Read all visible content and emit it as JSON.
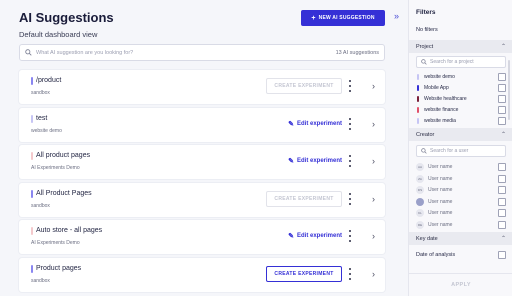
{
  "header": {
    "title": "AI Suggestions",
    "subtitle": "Default dashboard view",
    "new_button": "NEW AI SUGGESTION",
    "new_button_icon": "plus-icon"
  },
  "search": {
    "placeholder": "What AI suggestion are you looking for?",
    "count": "13 AI suggestions"
  },
  "cards": [
    {
      "name": "/product",
      "project": "sandbox",
      "action": "CREATE EXPERIMENT",
      "action_type": "disabled",
      "color": "#8a86f0"
    },
    {
      "name": "test",
      "project": "website demo",
      "action": "Edit experiment",
      "action_type": "edit",
      "color": "#c6c5f4"
    },
    {
      "name": "All product pages",
      "project": "AI Experiments Demo",
      "action": "Edit experiment",
      "action_type": "edit",
      "color": "#f4c9cc"
    },
    {
      "name": "All Product Pages",
      "project": "sandbox",
      "action": "CREATE EXPERIMENT",
      "action_type": "disabled",
      "color": "#8a86f0"
    },
    {
      "name": "Auto store - all pages",
      "project": "AI Experiments Demo",
      "action": "Edit experiment",
      "action_type": "edit",
      "color": "#f4c9cc"
    },
    {
      "name": "Product pages",
      "project": "sandbox",
      "action": "CREATE EXPERIMENT",
      "action_type": "enabled",
      "color": "#8a86f0"
    }
  ],
  "filters": {
    "title": "Filters",
    "no_filters": "No filters",
    "project_section": "Project",
    "project_search_placeholder": "Search for a project",
    "projects": [
      {
        "label": "website demo",
        "color": "#c6c5f4"
      },
      {
        "label": "Mobile App",
        "color": "#3530d6"
      },
      {
        "label": "Website healthcare",
        "color": "#7a1f3a"
      },
      {
        "label": "website finance",
        "color": "#e0506a"
      },
      {
        "label": "website media",
        "color": "#c6c5f4"
      }
    ],
    "creator_section": "Creator",
    "creator_search_placeholder": "Search for a user",
    "creators": [
      {
        "initials": "AA",
        "label": "User name",
        "photo": false
      },
      {
        "initials": "ZA",
        "label": "User name",
        "photo": false
      },
      {
        "initials": "DS",
        "label": "User name",
        "photo": false
      },
      {
        "initials": "",
        "label": "User name",
        "photo": true
      },
      {
        "initials": "KL",
        "label": "User name",
        "photo": false
      },
      {
        "initials": "RE",
        "label": "User name",
        "photo": false
      }
    ],
    "key_date_section": "Key date",
    "date_of_analysis": "Date of analysis",
    "apply": "APPLY"
  },
  "colors": {
    "accent": "#3530d6"
  }
}
